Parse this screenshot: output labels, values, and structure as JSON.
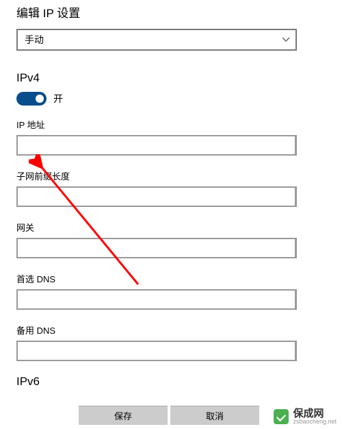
{
  "title": "编辑 IP 设置",
  "mode_select": {
    "value": "手动"
  },
  "ipv4": {
    "header": "IPv4",
    "toggle_state": "开",
    "fields": {
      "ip_label": "IP 地址",
      "ip_value": "",
      "subnet_label": "子网前缀长度",
      "subnet_value": "",
      "gateway_label": "网关",
      "gateway_value": "",
      "dns1_label": "首选 DNS",
      "dns1_value": "",
      "dns2_label": "备用 DNS",
      "dns2_value": ""
    }
  },
  "ipv6": {
    "header": "IPv6"
  },
  "buttons": {
    "save": "保存",
    "cancel": "取消"
  },
  "watermark": {
    "main": "保成网",
    "sub": "zsbaocheng.net"
  }
}
